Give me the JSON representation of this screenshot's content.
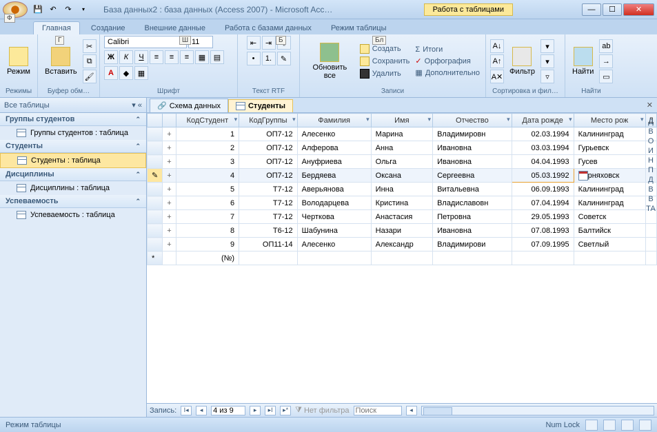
{
  "title": "База данных2 : база данных (Access 2007) - Microsoft Acc…",
  "context_tab": "Работа с таблицами",
  "tabs": [
    "Главная",
    "Создание",
    "Внешние данные",
    "Работа с базами данных",
    "Режим таблицы"
  ],
  "ribbon": {
    "modes": "Режимы",
    "mode_btn": "Режим",
    "clipboard": "Буфер обм…",
    "paste": "Вставить",
    "font_group": "Шрифт",
    "font_name": "Calibri",
    "font_size": "11",
    "rtf": "Текст RTF",
    "refresh_btn": "Обновить все",
    "records": "Записи",
    "create": "Создать",
    "save": "Сохранить",
    "delete": "Удалить",
    "totals": "Итоги",
    "spell": "Орфография",
    "more": "Дополнительно",
    "sort_group": "Сортировка и фил…",
    "filter": "Фильтр",
    "find_group": "Найти",
    "find": "Найти"
  },
  "nav": {
    "header": "Все таблицы",
    "cats": [
      {
        "title": "Группы студентов",
        "items": [
          "Группы студентов : таблица"
        ]
      },
      {
        "title": "Студенты",
        "items": [
          "Студенты : таблица"
        ],
        "sel": 0
      },
      {
        "title": "Дисциплины",
        "items": [
          "Дисциплины : таблица"
        ]
      },
      {
        "title": "Успеваемость",
        "items": [
          "Успеваемость : таблица"
        ]
      }
    ]
  },
  "doc_tabs": [
    {
      "label": "Схема данных",
      "active": false
    },
    {
      "label": "Студенты",
      "active": true
    }
  ],
  "columns": [
    "КодСтудент",
    "КодГруппы",
    "Фамилия",
    "Имя",
    "Отчество",
    "Дата рожде",
    "Место рож"
  ],
  "rows": [
    [
      "1",
      "ОП7-12",
      "Алесенко",
      "Марина",
      "Владимировн",
      "02.03.1994",
      "Калининград"
    ],
    [
      "2",
      "ОП7-12",
      "Алферова",
      "Анна",
      "Ивановна",
      "03.03.1994",
      "Гурьевск"
    ],
    [
      "3",
      "ОП7-12",
      "Ануфриева",
      "Ольга",
      "Ивановна",
      "04.04.1993",
      "Гусев"
    ],
    [
      "4",
      "ОП7-12",
      "Бердяева",
      "Оксана",
      "Сергеевна",
      "05.03.1992",
      "рняховск"
    ],
    [
      "5",
      "Т7-12",
      "Аверьянова",
      "Инна",
      "Витальевна",
      "06.09.1993",
      "Калининград"
    ],
    [
      "6",
      "Т7-12",
      "Володарцева",
      "Кристина",
      "Владиславовн",
      "07.04.1994",
      "Калининград"
    ],
    [
      "7",
      "Т7-12",
      "Черткова",
      "Анастасия",
      "Петровна",
      "29.05.1993",
      "Советск"
    ],
    [
      "8",
      "Т6-12",
      "Шабунина",
      "Назари",
      "Ивановна",
      "07.08.1993",
      "Балтийск"
    ],
    [
      "9",
      "ОП11-14",
      "Алесенко",
      "Александр",
      "Владимирови",
      "07.09.1995",
      "Светлый"
    ]
  ],
  "new_row_placeholder": "(№)",
  "edit_row_index": 3,
  "record_nav": {
    "label": "Запись:",
    "pos": "4 из 9",
    "filter": "Нет фильтра",
    "search": "Поиск"
  },
  "status": {
    "left": "Режим таблицы",
    "right": "Num Lock"
  },
  "keytips": {
    "f": "Ф",
    "g": "Г",
    "sh": "Ш",
    "b": "Б",
    "bl": "Бл"
  },
  "side": [
    "Д",
    "В",
    "О",
    "И",
    "Н",
    "П",
    "Д",
    "В",
    "В",
    "ТА"
  ]
}
